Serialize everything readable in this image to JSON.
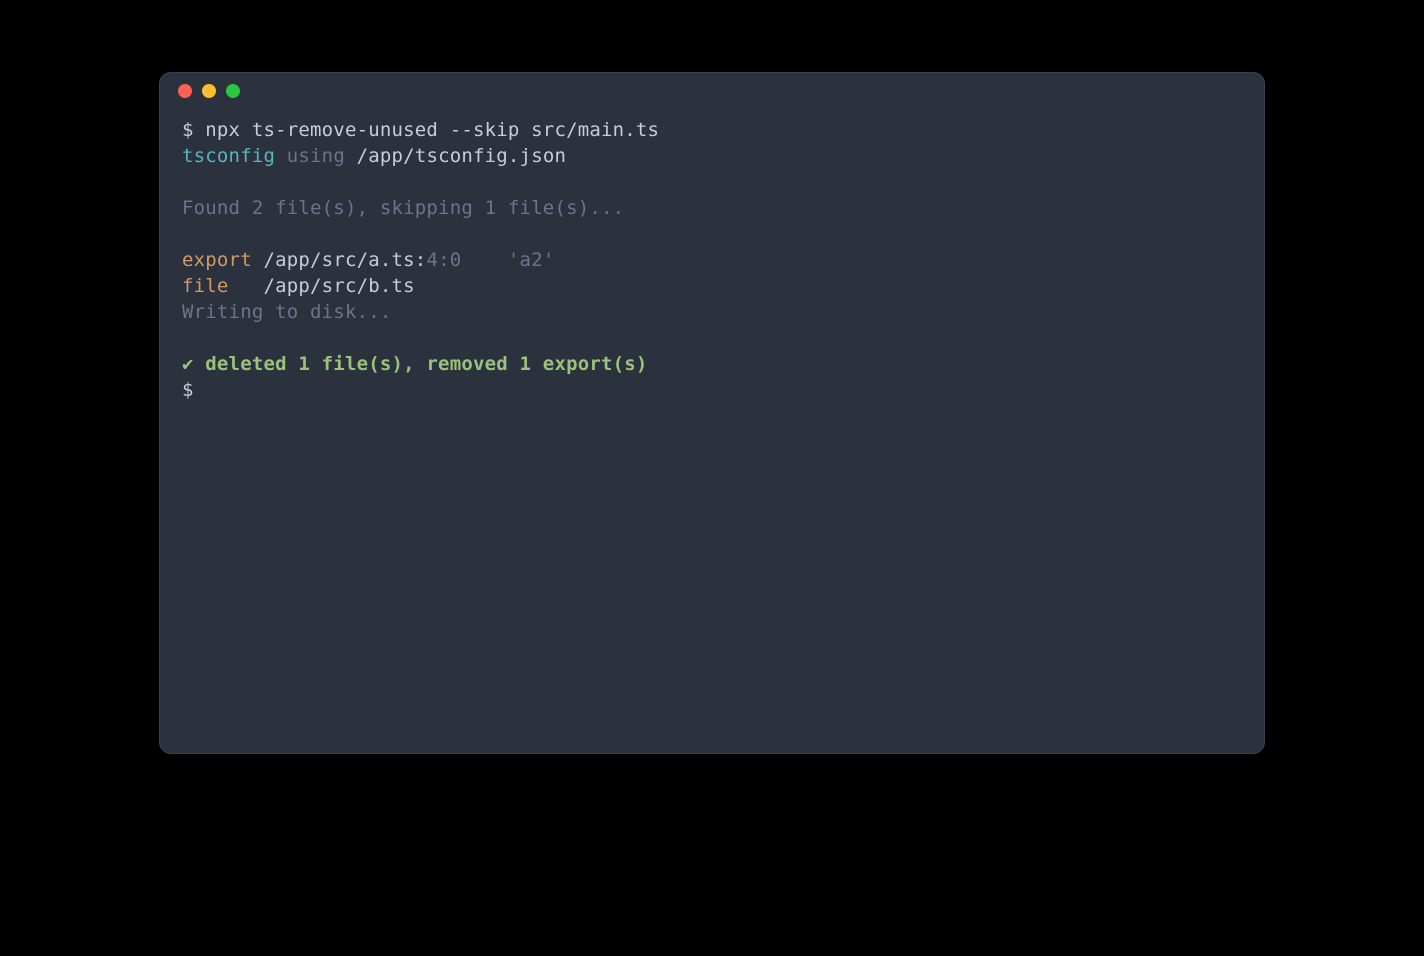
{
  "terminal": {
    "prompt": "$ ",
    "command": "npx ts-remove-unused --skip src/main.ts",
    "line2": {
      "label": "tsconfig",
      "using": " using ",
      "path": "/app/tsconfig.json"
    },
    "found": "Found 2 file(s), skipping 1 file(s)...",
    "export_line": {
      "label": "export",
      "space1": " ",
      "path": "/app/src/a.ts:",
      "loc": "4:0",
      "space2": "    ",
      "name": "'a2'"
    },
    "file_line": {
      "label": "file",
      "space": "   ",
      "path": "/app/src/b.ts"
    },
    "writing": "Writing to disk...",
    "success": "✔ deleted 1 file(s), removed 1 export(s)",
    "prompt2": "$ "
  }
}
